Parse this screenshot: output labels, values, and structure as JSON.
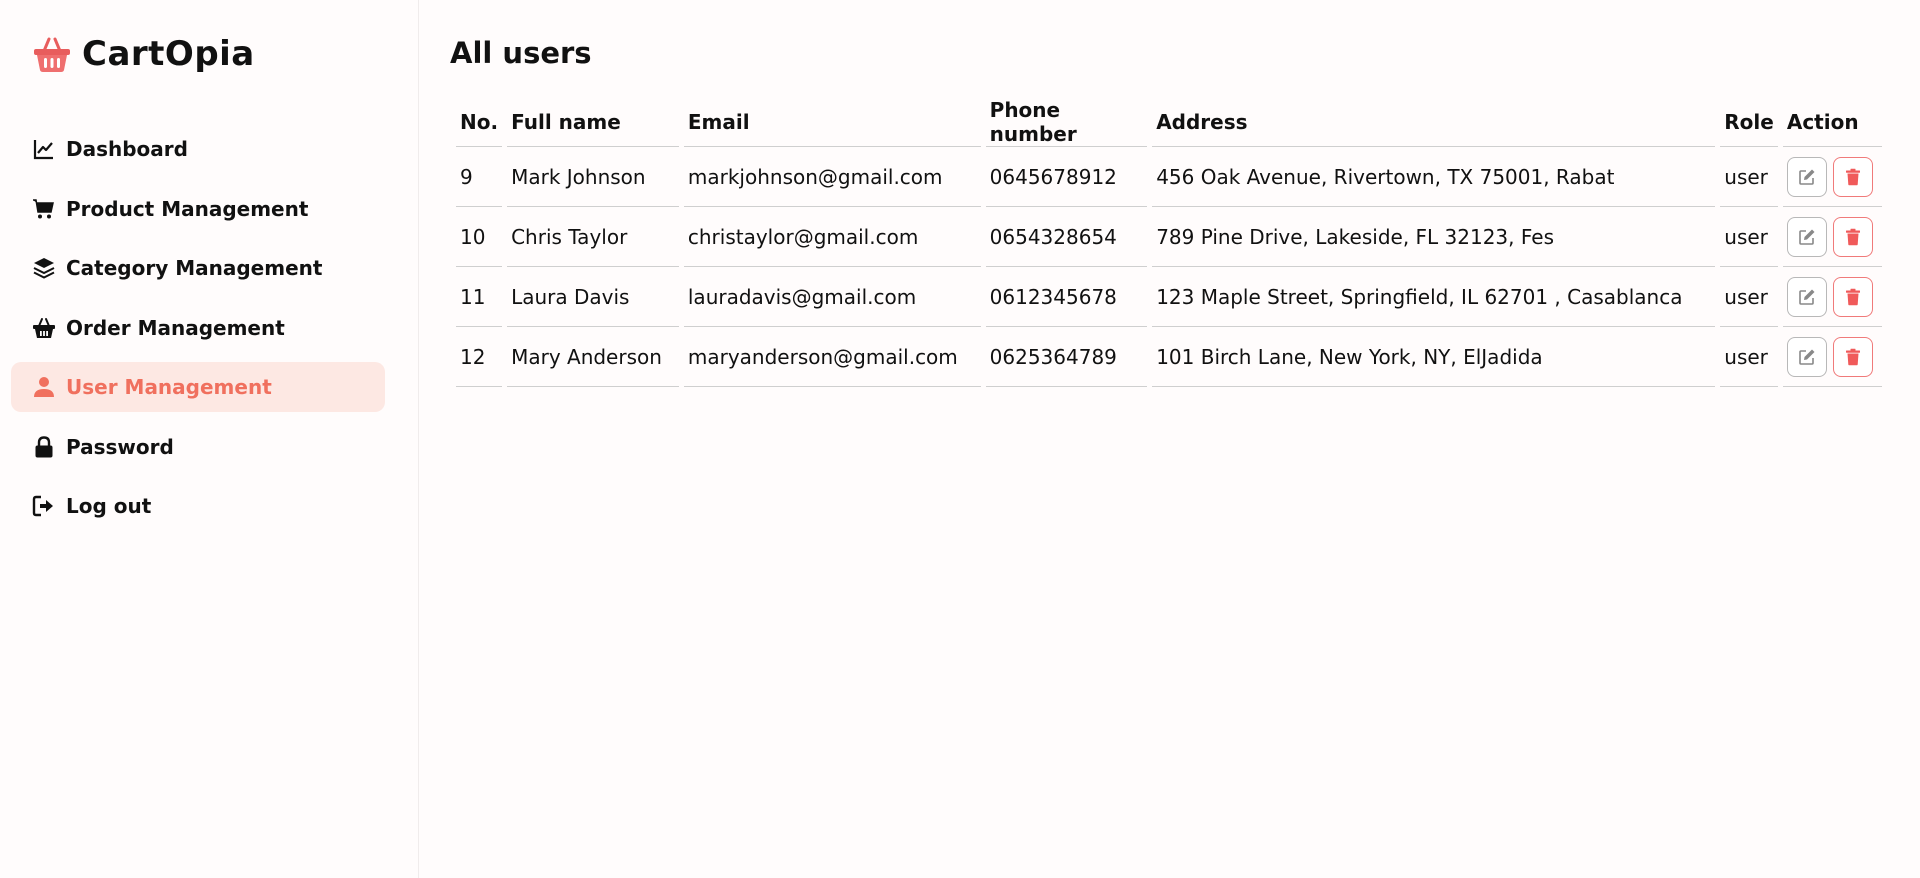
{
  "brand": {
    "name": "CartOpia",
    "icon": "basket-icon",
    "color": "#e85d5d"
  },
  "sidebar": {
    "items": [
      {
        "label": "Dashboard",
        "icon": "chart-line-icon",
        "active": false
      },
      {
        "label": "Product Management",
        "icon": "cart-icon",
        "active": false
      },
      {
        "label": "Category Management",
        "icon": "layers-icon",
        "active": false
      },
      {
        "label": "Order Management",
        "icon": "basket-icon",
        "active": false
      },
      {
        "label": "User Management",
        "icon": "user-icon",
        "active": true
      },
      {
        "label": "Password",
        "icon": "lock-icon",
        "active": false
      },
      {
        "label": "Log out",
        "icon": "logout-icon",
        "active": false
      }
    ],
    "active_color": "#f0705e",
    "active_bg": "#fde8e3"
  },
  "main": {
    "title": "All users",
    "table": {
      "headers": [
        "No.",
        "Full name",
        "Email",
        "Phone number",
        "Address",
        "Role",
        "Action"
      ],
      "rows": [
        {
          "no": "9",
          "name": "Mark Johnson",
          "email": "markjohnson@gmail.com",
          "phone": "0645678912",
          "address": "456 Oak Avenue, Rivertown, TX 75001, Rabat",
          "role": "user"
        },
        {
          "no": "10",
          "name": "Chris Taylor",
          "email": "christaylor@gmail.com",
          "phone": "0654328654",
          "address": "789 Pine Drive, Lakeside, FL 32123, Fes",
          "role": "user"
        },
        {
          "no": "11",
          "name": "Laura Davis",
          "email": "lauradavis@gmail.com",
          "phone": "0612345678",
          "address": "123 Maple Street, Springfield, IL 62701 , Casablanca",
          "role": "user"
        },
        {
          "no": "12",
          "name": "Mary Anderson",
          "email": "maryanderson@gmail.com",
          "phone": "0625364789",
          "address": "101 Birch Lane, New York, NY, ElJadida",
          "role": "user"
        }
      ],
      "actions": {
        "edit_icon": "edit-icon",
        "delete_icon": "trash-icon",
        "delete_color": "#f05a5a"
      }
    }
  }
}
